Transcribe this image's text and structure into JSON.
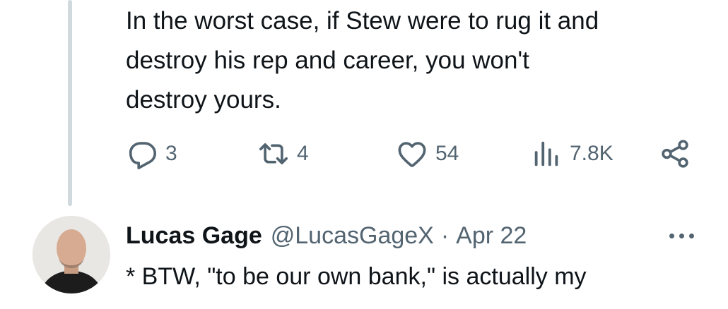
{
  "tweet": {
    "text": "In the worst case, if Stew were to rug it and\ndestroy his rep and career, you won't\ndestroy yours.",
    "replies_count": "3",
    "reposts_count": "4",
    "likes_count": "54",
    "views_count": "7.8K"
  },
  "reply": {
    "author_name": "Lucas Gage",
    "handle": "@LucasGageX",
    "separator": "·",
    "date": "Apr 22",
    "text": "* BTW, \"to be our own bank,\" is actually my"
  },
  "icons": [
    "reply-icon",
    "repost-icon",
    "like-icon",
    "views-icon",
    "share-icon",
    "more-icon"
  ],
  "colors": {
    "text": "#0f1419",
    "secondary": "#536471",
    "thread_line": "#cfd9de"
  }
}
